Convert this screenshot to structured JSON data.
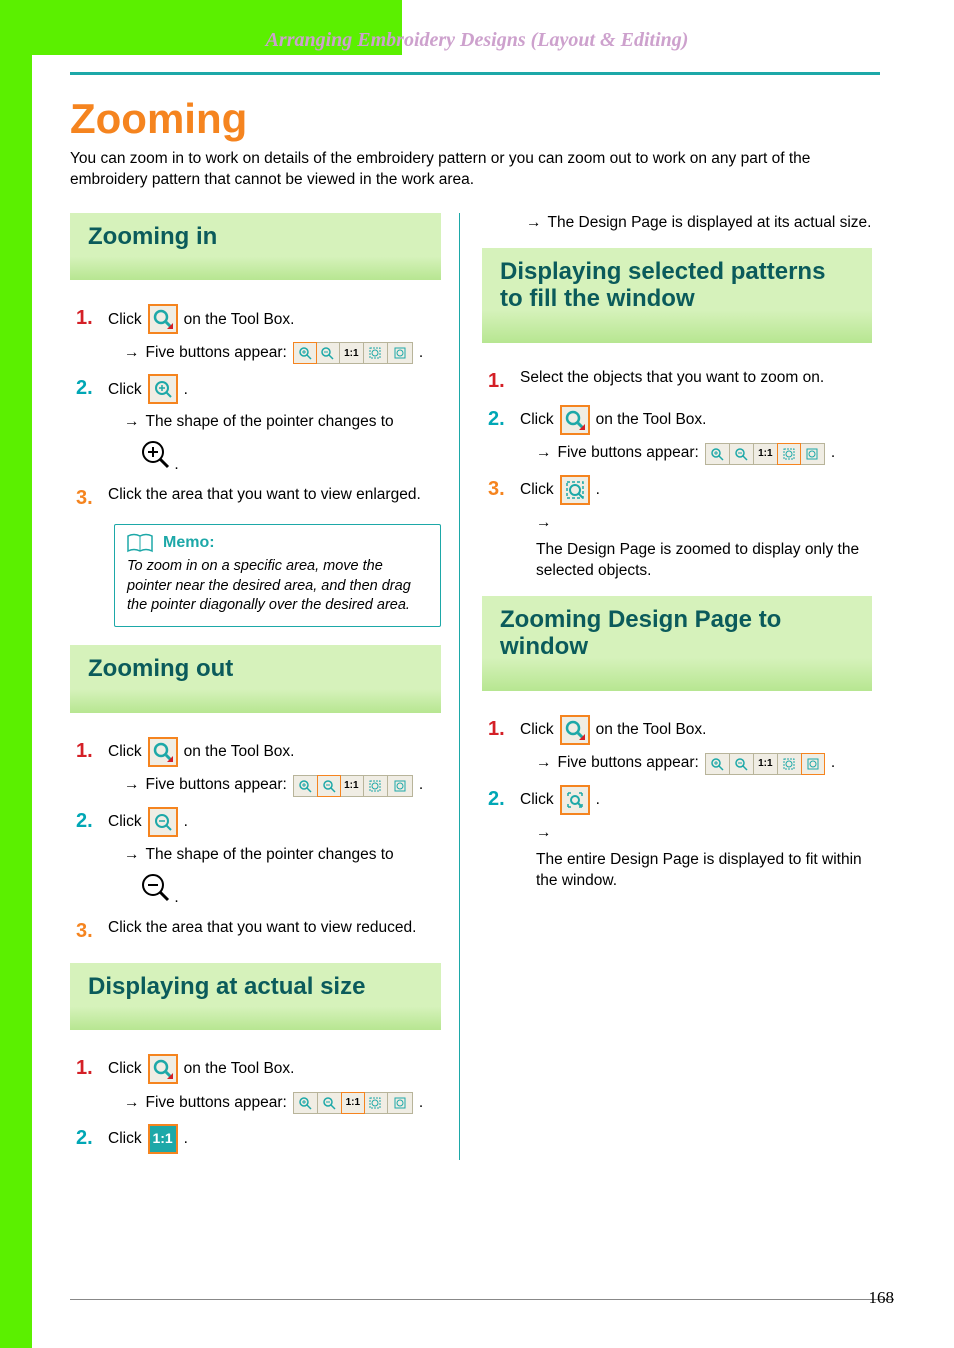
{
  "header": {
    "breadcrumb": "Arranging Embroidery Designs (Layout & Editing)"
  },
  "page_title": "Zooming",
  "intro": "You can zoom in to work on details of the embroidery pattern or you can zoom out to work on any part of the embroidery pattern that cannot be viewed in the work area.",
  "page_number": "168",
  "sections": {
    "zoom_in": {
      "title": "Zooming in",
      "steps": {
        "s1": {
          "num": "1.",
          "pre": "Click",
          "post": "on the Tool Box."
        },
        "s1_sub": "Five buttons appear:",
        "s2": {
          "num": "2.",
          "pre": "Click",
          "post": "."
        },
        "s2_sub": "The shape of the pointer changes to",
        "s2_sub_post": ".",
        "s3": {
          "num": "3.",
          "text": "Click the area that you want to view enlarged."
        }
      },
      "memo": {
        "title": "Memo:",
        "body": "To zoom in on a specific area, move the pointer near the desired area, and then drag the pointer diagonally over the desired area."
      }
    },
    "zoom_out": {
      "title": "Zooming out",
      "steps": {
        "s1": {
          "num": "1.",
          "pre": "Click",
          "post": "on the Tool Box."
        },
        "s1_sub": "Five buttons appear:",
        "s2": {
          "num": "2.",
          "pre": "Click",
          "post": "."
        },
        "s2_sub": "The shape of the pointer changes to",
        "s2_sub_post": ".",
        "s3": {
          "num": "3.",
          "text": "Click the area that you want to view reduced."
        }
      }
    },
    "actual_size": {
      "title": "Displaying at actual size",
      "steps": {
        "s1": {
          "num": "1.",
          "pre": "Click",
          "post": "on the Tool Box."
        },
        "s1_sub": "Five buttons appear:",
        "s2": {
          "num": "2.",
          "pre": "Click",
          "post": "."
        }
      }
    },
    "actual_size_result": "The Design Page is displayed at its actual size.",
    "selected_fill": {
      "title": "Displaying selected patterns to fill the window",
      "steps": {
        "s1": {
          "num": "1.",
          "text": "Select the objects that you want to zoom on."
        },
        "s2": {
          "num": "2.",
          "pre": "Click",
          "post": "on the Tool Box."
        },
        "s2_sub": "Five buttons appear:",
        "s3": {
          "num": "3.",
          "pre": "Click",
          "post": "."
        },
        "s3_sub": "The Design Page is zoomed to display only the selected objects."
      }
    },
    "design_to_window": {
      "title": "Zooming Design Page to window",
      "steps": {
        "s1": {
          "num": "1.",
          "pre": "Click",
          "post": "on the Tool Box."
        },
        "s1_sub": "Five buttons appear:",
        "s2": {
          "num": "2.",
          "pre": "Click",
          "post": "."
        },
        "s2_sub": "The entire Design Page is displayed to fit within the window."
      }
    }
  },
  "icons": {
    "zoom_tool": "zoom-tool-icon",
    "zoom_in": "zoom-in-icon",
    "zoom_out": "zoom-out-icon",
    "one_to_one": "1:1",
    "fit_selected": "fit-selected-icon",
    "fit_page": "fit-page-icon"
  },
  "arrow": "→",
  "step_colors": [
    "#d41f26",
    "#00a7b5",
    "#f5841f"
  ]
}
